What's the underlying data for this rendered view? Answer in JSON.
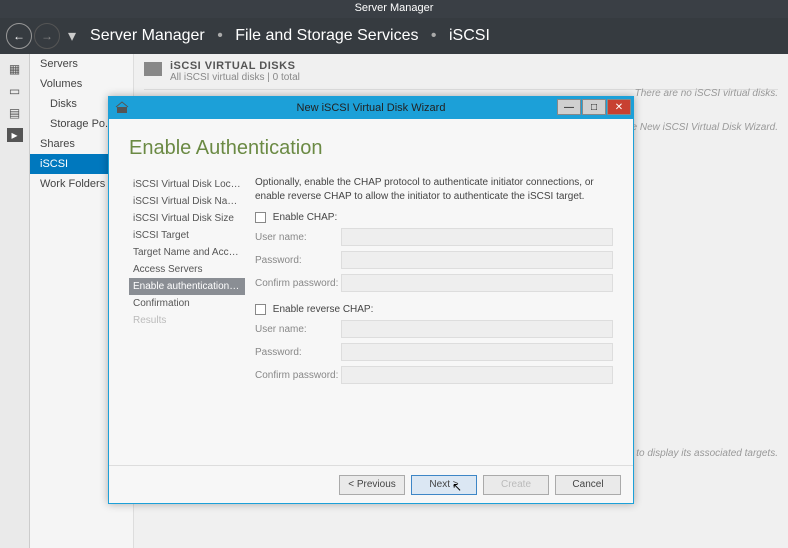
{
  "app": {
    "title": "Server Manager"
  },
  "breadcrumb": {
    "root": "Server Manager",
    "level1": "File and Storage Services",
    "level2": "iSCSI"
  },
  "rail": {
    "items": [
      "dashboard",
      "servers",
      "volumes",
      "iscsi"
    ]
  },
  "side_nav": {
    "items": [
      {
        "label": "Servers"
      },
      {
        "label": "Volumes"
      },
      {
        "label": "Disks"
      },
      {
        "label": "Storage Po..."
      },
      {
        "label": "Shares"
      },
      {
        "label": "iSCSI"
      },
      {
        "label": "Work Folders"
      }
    ]
  },
  "content": {
    "section_title": "iSCSI VIRTUAL DISKS",
    "section_sub": "All iSCSI virtual disks | 0 total",
    "empty_hint": "There are no iSCSI virtual disks.",
    "create_hint": "To create an iSCSI virtual disk, start the New iSCSI Virtual Disk Wizard.",
    "target_hint": "Select an iSCSI VHD to display its associated targets."
  },
  "wizard": {
    "title": "New iSCSI Virtual Disk Wizard",
    "heading": "Enable Authentication",
    "steps": [
      "iSCSI Virtual Disk Location",
      "iSCSI Virtual Disk Name",
      "iSCSI Virtual Disk Size",
      "iSCSI Target",
      "Target Name and Access",
      "Access Servers",
      "Enable authentication ser...",
      "Confirmation",
      "Results"
    ],
    "description": "Optionally, enable the CHAP protocol to authenticate initiator connections, or enable reverse CHAP to allow the initiator to authenticate the iSCSI target.",
    "chap": {
      "enable_label": "Enable CHAP:",
      "user_label": "User name:",
      "pass_label": "Password:",
      "confirm_label": "Confirm password:"
    },
    "reverse": {
      "enable_label": "Enable reverse CHAP:",
      "user_label": "User name:",
      "pass_label": "Password:",
      "confirm_label": "Confirm password:"
    },
    "buttons": {
      "prev": "< Previous",
      "next": "Next >",
      "create": "Create",
      "cancel": "Cancel"
    }
  }
}
